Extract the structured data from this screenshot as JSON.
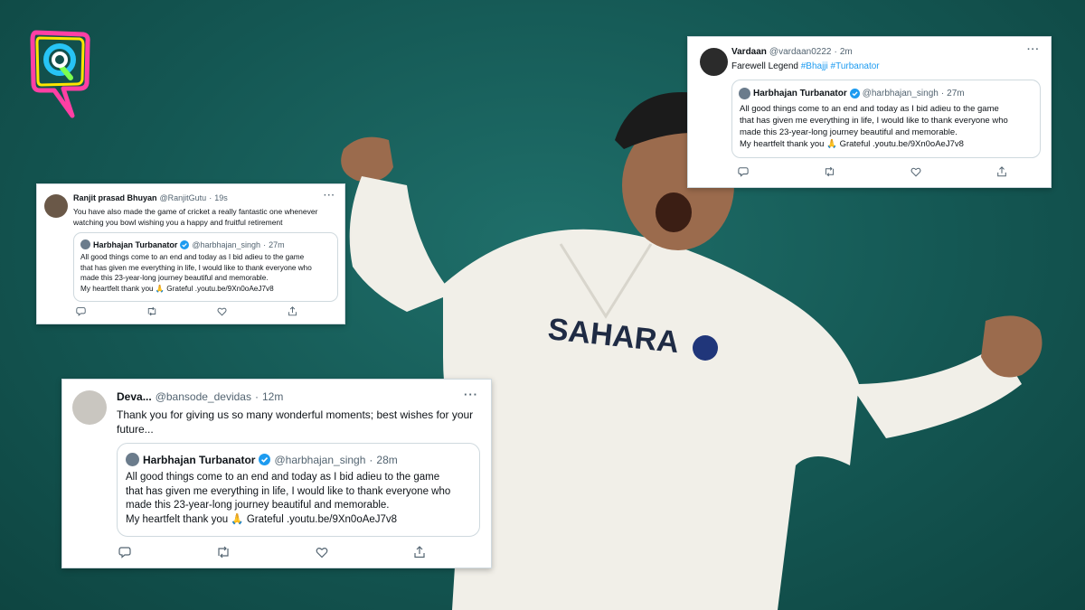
{
  "colors": {
    "background": "#145753",
    "link": "#1d9bf0",
    "secondary_text": "#536471",
    "verified": "#1d9bf0",
    "logo_outline": [
      "#ff3fa4",
      "#ffe600",
      "#27c4f5",
      "#7cff4f"
    ]
  },
  "logo": {
    "icon": "the-quint-q-logo"
  },
  "tweet_a": {
    "name": "Vardaan",
    "handle": "@vardaan0222",
    "dot": "·",
    "time": "2m",
    "more": "···",
    "text_prefix": "Farewell Legend ",
    "hashtag_1": "#Bhajji",
    "hashtag_2": "#Turbanator",
    "quote": {
      "name": "Harbhajan Turbanator",
      "handle": "@harbhajan_singh",
      "dot": "·",
      "time": "27m",
      "text": "All good things come to an end and today as I bid adieu to the game\nthat has given me everything in life, I would like to thank everyone who\nmade this 23-year-long journey beautiful and memorable.\nMy heartfelt thank you 🙏 Grateful .youtu.be/9Xn0oAeJ7v8"
    }
  },
  "tweet_b": {
    "name": "Ranjit prasad Bhuyan",
    "handle": "@RanjitGutu",
    "dot": "·",
    "time": "19s",
    "more": "···",
    "text": "You have also made the game of cricket a really fantastic one whenever\nwatching you bowl wishing you a happy and fruitful retirement",
    "quote": {
      "name": "Harbhajan Turbanator",
      "handle": "@harbhajan_singh",
      "dot": "·",
      "time": "27m",
      "text": "All good things come to an end and today as I bid adieu to the game\nthat has given me everything in life, I would like to thank everyone who\nmade this 23-year-long journey beautiful and memorable.\nMy heartfelt thank you 🙏 Grateful .youtu.be/9Xn0oAeJ7v8"
    }
  },
  "tweet_c": {
    "name": "Deva...",
    "handle": "@bansode_devidas",
    "dot": "·",
    "time": "12m",
    "more": "···",
    "text": "Thank you for giving us so many wonderful moments; best wishes for your\nfuture...",
    "quote": {
      "name": "Harbhajan Turbanator",
      "handle": "@harbhajan_singh",
      "dot": "·",
      "time": "28m",
      "text": "All good things come to an end and today as I bid adieu to the game\nthat has given me everything in life, I would like to thank everyone who\nmade this 23-year-long journey beautiful and memorable.\nMy heartfelt thank you 🙏 Grateful .youtu.be/9Xn0oAeJ7v8"
    }
  },
  "actions": [
    "reply-icon",
    "retweet-icon",
    "like-icon",
    "share-icon"
  ],
  "photo": {
    "jersey_text": "SAHARA"
  }
}
